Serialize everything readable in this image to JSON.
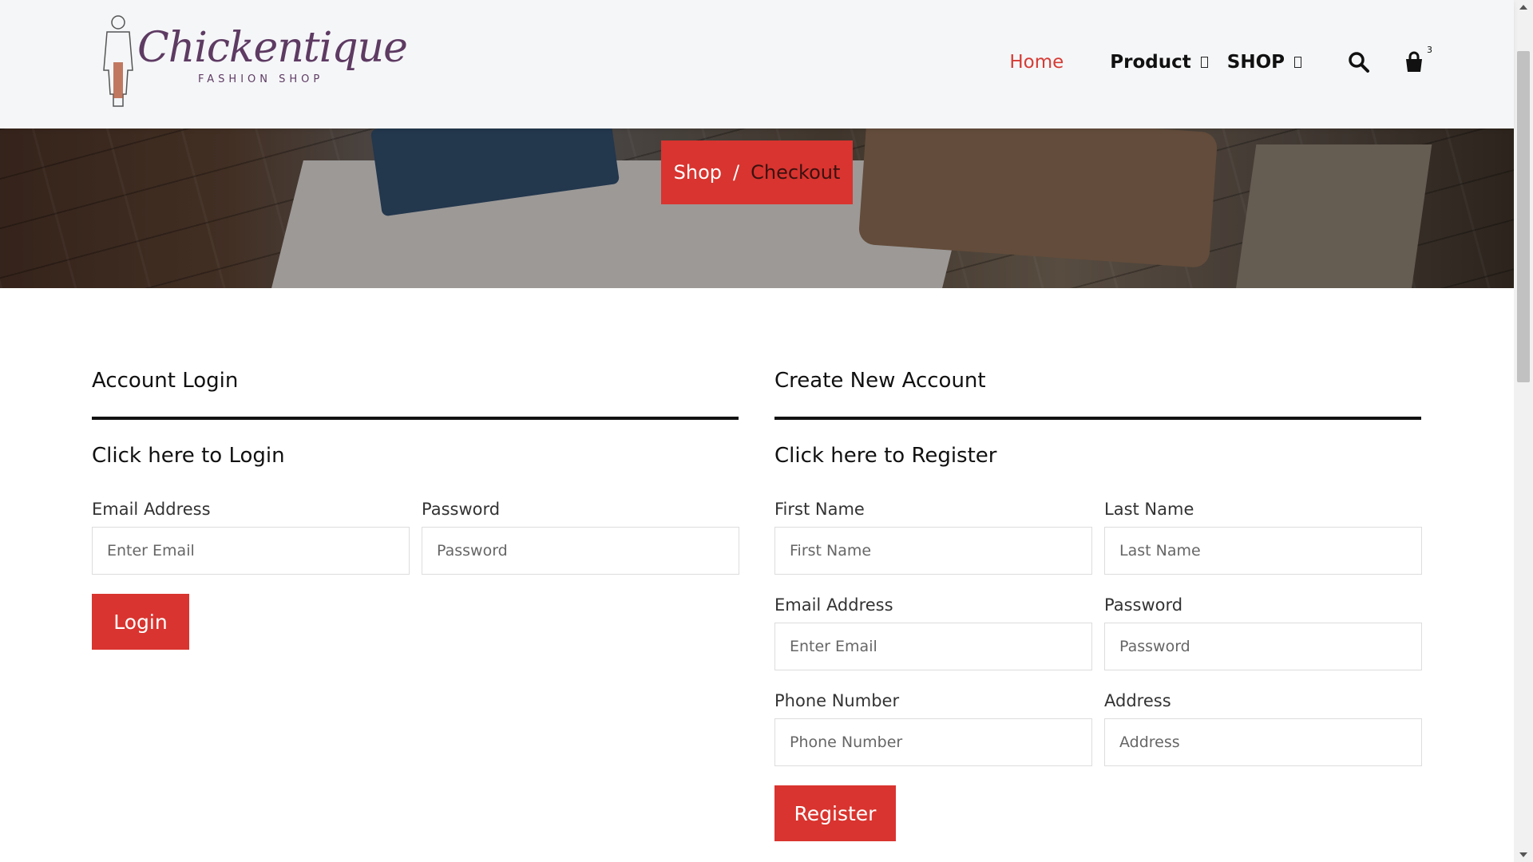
{
  "logo": {
    "script_text": "Chickentique",
    "tagline": "FASHION SHOP"
  },
  "nav": {
    "home": "Home",
    "product": "Product",
    "shop": "SHOP",
    "cart_count": "3"
  },
  "breadcrumb": {
    "shop": "Shop",
    "separator": "/",
    "current": "Checkout"
  },
  "login": {
    "section_title": "Account Login",
    "sub_title": "Click here to Login",
    "email_label": "Email Address",
    "email_placeholder": "Enter Email",
    "password_label": "Password",
    "password_placeholder": "Password",
    "button": "Login"
  },
  "register": {
    "section_title": "Create New Account",
    "sub_title": "Click here to Register",
    "first_name_label": "First Name",
    "first_name_placeholder": "First Name",
    "last_name_label": "Last Name",
    "last_name_placeholder": "Last Name",
    "email_label": "Email Address",
    "email_placeholder": "Enter Email",
    "password_label": "Password",
    "password_placeholder": "Password",
    "phone_label": "Phone Number",
    "phone_placeholder": "Phone Number",
    "address_label": "Address",
    "address_placeholder": "Address",
    "button": "Register"
  },
  "colors": {
    "accent": "#d9342f",
    "brand": "#5e3b63"
  }
}
